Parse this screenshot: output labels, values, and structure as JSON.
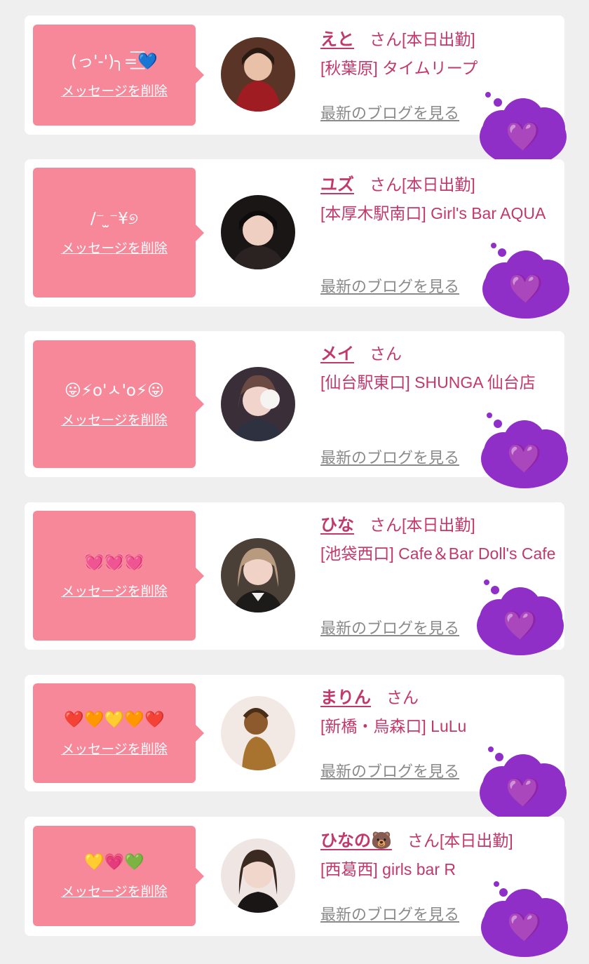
{
  "cards": [
    {
      "message": "(っ'-')╮=͟͟͞💙",
      "delete_label": "メッセージを削除",
      "name": "えと",
      "suffix": "さん",
      "status": "[本日出勤]",
      "shop": "[秋葉原] タイムリープ",
      "blog_label": "最新のブログを見る",
      "reaction": "💜"
    },
    {
      "message": "/⁻ ̫⁻¥୭",
      "delete_label": "メッセージを削除",
      "name": "ユズ",
      "suffix": "さん",
      "status": "[本日出勤]",
      "shop": "[本厚木駅南口] Girl's Bar AQUA",
      "blog_label": "最新のブログを見る",
      "reaction": "💜"
    },
    {
      "message": "😛⚡o'ㅅ'o⚡😛",
      "delete_label": "メッセージを削除",
      "name": "メイ",
      "suffix": "さん",
      "status": "",
      "shop": "[仙台駅東口] SHUNGA 仙台店",
      "blog_label": "最新のブログを見る",
      "reaction": "💜"
    },
    {
      "message": "💓💓💓",
      "delete_label": "メッセージを削除",
      "name": "ひな",
      "suffix": "さん",
      "status": "[本日出勤]",
      "shop": "[池袋西口] Cafe＆Bar Doll's Cafe",
      "blog_label": "最新のブログを見る",
      "reaction": "💜"
    },
    {
      "message": "❤️🧡💛🧡❤️",
      "delete_label": "メッセージを削除",
      "name": "まりん",
      "suffix": "さん",
      "status": "",
      "shop": "[新橋・烏森口] LuLu",
      "blog_label": "最新のブログを見る",
      "reaction": "💜"
    },
    {
      "message": "💛💗💚",
      "delete_label": "メッセージを削除",
      "name": "ひなの🐻",
      "suffix": "さん",
      "status": "[本日出勤]",
      "shop": "[西葛西] girls bar R",
      "blog_label": "最新のブログを見る",
      "reaction": "💜"
    }
  ],
  "colors": {
    "background": "#f0eff0",
    "card": "#ffffff",
    "bubble": "#f7889a",
    "accent_text": "#c2386a",
    "link_gray": "#8a8a8a",
    "reaction_cloud": "#8f2fc8"
  }
}
